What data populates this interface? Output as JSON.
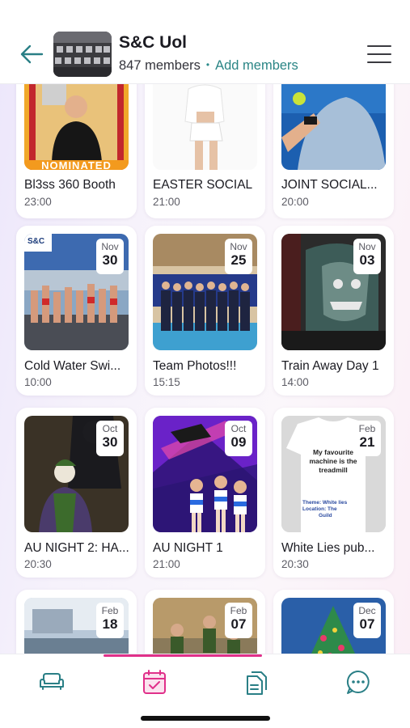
{
  "header": {
    "group_name": "S&C Uol",
    "members": "847 members",
    "separator": "•",
    "add_members": "Add members"
  },
  "events": [
    {
      "title": "Bl3ss 360 Booth",
      "time": "23:00",
      "month": "",
      "day": ""
    },
    {
      "title": "EASTER SOCIAL",
      "time": "21:00",
      "month": "",
      "day": ""
    },
    {
      "title": "JOINT SOCIAL...",
      "time": "20:00",
      "month": "",
      "day": ""
    },
    {
      "title": "Cold Water Swi...",
      "time": "10:00",
      "month": "Nov",
      "day": "30"
    },
    {
      "title": "Team Photos!!!",
      "time": "15:15",
      "month": "Nov",
      "day": "25"
    },
    {
      "title": "Train Away Day 1",
      "time": "14:00",
      "month": "Nov",
      "day": "03"
    },
    {
      "title": "AU NIGHT 2: HA...",
      "time": "20:30",
      "month": "Oct",
      "day": "30"
    },
    {
      "title": "AU NIGHT 1",
      "time": "21:00",
      "month": "Oct",
      "day": "09"
    },
    {
      "title": "White Lies pub...",
      "time": "20:30",
      "month": "Feb",
      "day": "21"
    },
    {
      "title": "",
      "time": "",
      "month": "Feb",
      "day": "18"
    },
    {
      "title": "",
      "time": "",
      "month": "Feb",
      "day": "07"
    },
    {
      "title": "",
      "time": "",
      "month": "Dec",
      "day": "07"
    }
  ],
  "images": {
    "nominated_text": "NOMINATED",
    "swim_logo": "S&C",
    "tshirt_line1": "My favourite",
    "tshirt_line2": "machine is the",
    "tshirt_line3": "treadmill",
    "tshirt_theme": "Theme: White lies",
    "tshirt_location": "Location: The",
    "tshirt_venue": "Guild"
  },
  "nav": {
    "items": [
      "couch-icon",
      "calendar-icon",
      "documents-icon",
      "chat-icon"
    ],
    "active": 1
  },
  "colors": {
    "accent_teal": "#2a8585",
    "accent_pink": "#e0308a"
  }
}
